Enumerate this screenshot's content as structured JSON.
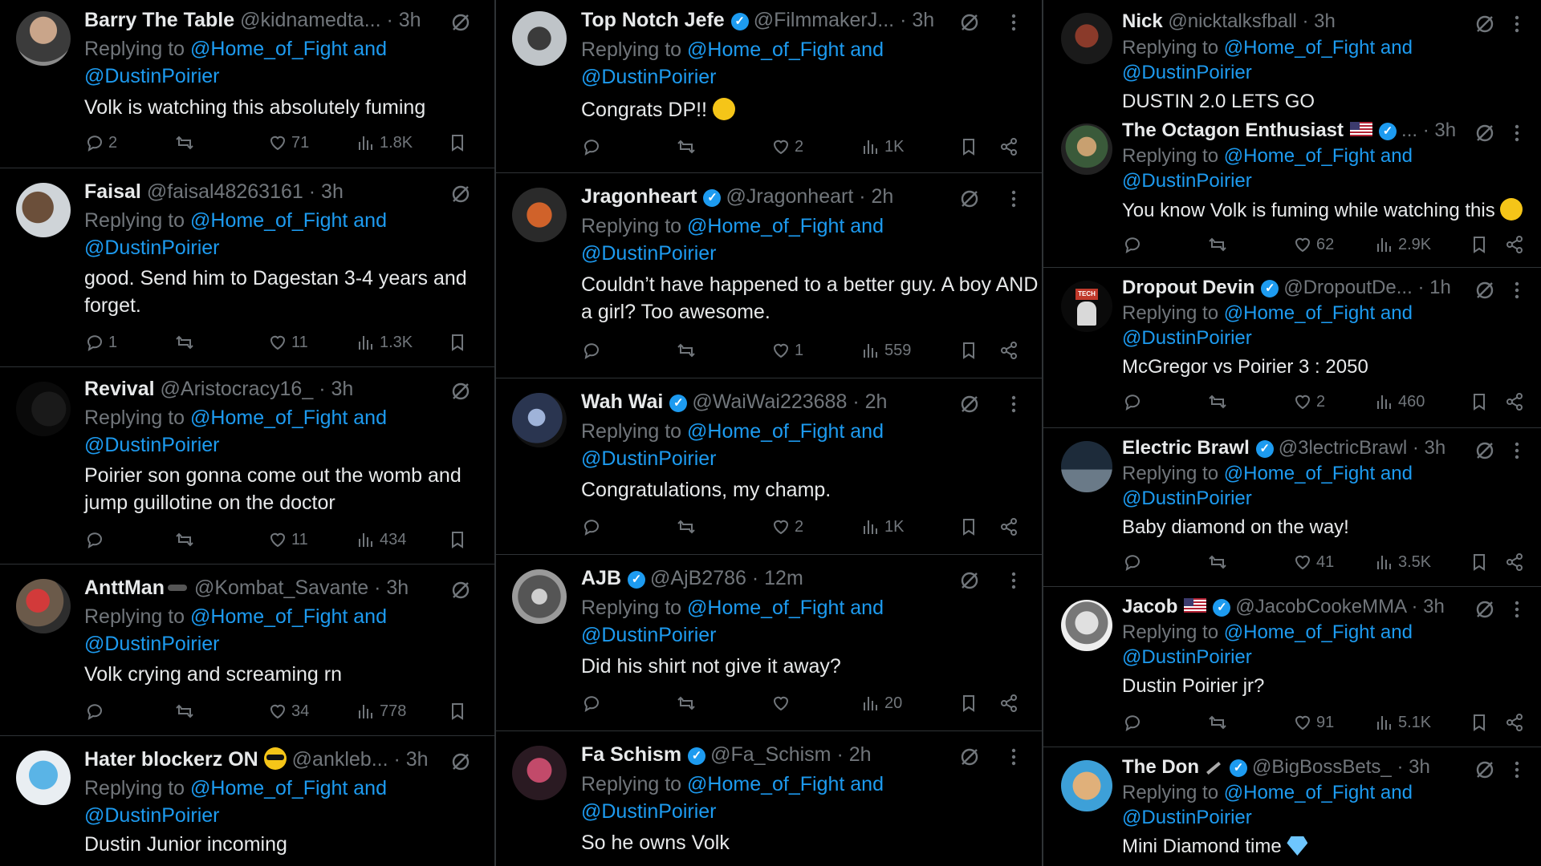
{
  "colors": {
    "background": "#000000",
    "text": "#e7e9ea",
    "muted": "#71767b",
    "link": "#1d9bf0",
    "divider": "#2f3336",
    "verified": "#1d9bf0"
  },
  "icons": {
    "reply": "reply-icon",
    "retweet": "retweet-icon",
    "like": "heart-icon",
    "views": "views-icon",
    "bookmark": "bookmark-icon",
    "share": "share-icon",
    "grok": "grok-icon",
    "more": "more-icon"
  },
  "columns": [
    {
      "tweets": [
        {
          "name": "Barry The Table",
          "handle": "@kidnamedta...",
          "time": "· 3h",
          "replying_prefix": "Replying to",
          "replying_link1": "@Home_of_Fight and",
          "replying_link2": "@DustinPoirier",
          "text": "Volk is watching this absolutely fuming",
          "replies": "2",
          "retweets": "",
          "likes": "71",
          "views": "1.8K"
        },
        {
          "name": "Faisal",
          "handle": "@faisal48263161",
          "time": "· 3h",
          "replying_prefix": "Replying to",
          "replying_link1": "@Home_of_Fight and",
          "replying_link2": "@DustinPoirier",
          "text": "good. Send him to Dagestan 3-4 years and forget.",
          "replies": "1",
          "retweets": "",
          "likes": "11",
          "views": "1.3K"
        },
        {
          "name": "Revival",
          "handle": "@Aristocracy16_",
          "time": "· 3h",
          "replying_prefix": "Replying to",
          "replying_link1": "@Home_of_Fight and",
          "replying_link2": "@DustinPoirier",
          "text": "Poirier son gonna come out the womb and jump guillotine on the doctor",
          "replies": "",
          "retweets": "",
          "likes": "11",
          "views": "434"
        },
        {
          "name": "AnttMan",
          "handle": "@Kombat_Savante",
          "time": "· 3h",
          "replying_prefix": "Replying to",
          "replying_link1": "@Home_of_Fight and",
          "replying_link2": "@DustinPoirier",
          "text": "Volk crying and screaming rn",
          "replies": "",
          "retweets": "",
          "likes": "34",
          "views": "778"
        },
        {
          "name": "Hater blockerz ON",
          "handle": "@ankleb...",
          "time": "· 3h",
          "replying_prefix": "Replying to",
          "replying_link1": "@Home_of_Fight and",
          "replying_link2": "@DustinPoirier",
          "text": "Dustin Junior incoming"
        }
      ]
    },
    {
      "tweets": [
        {
          "name": "Top Notch Jefe",
          "handle": "@FilmmakerJ...",
          "time": "· 3h",
          "replying_prefix": "Replying to",
          "replying_link1": "@Home_of_Fight and",
          "replying_link2": "@DustinPoirier",
          "text": "Congrats DP!!",
          "replies": "",
          "retweets": "",
          "likes": "2",
          "views": "1K"
        },
        {
          "name": "Jragonheart",
          "handle": "@Jragonheart",
          "time": "· 2h",
          "replying_prefix": "Replying to",
          "replying_link1": "@Home_of_Fight and",
          "replying_link2": "@DustinPoirier",
          "text": "Couldn’t have happened to a better guy. A boy AND a girl? Too awesome.",
          "replies": "",
          "retweets": "",
          "likes": "1",
          "views": "559"
        },
        {
          "name": "Wah Wai",
          "handle": "@WaiWai223688",
          "time": "· 2h",
          "replying_prefix": "Replying to",
          "replying_link1": "@Home_of_Fight and",
          "replying_link2": "@DustinPoirier",
          "text": "Congratulations, my champ.",
          "replies": "",
          "retweets": "",
          "likes": "2",
          "views": "1K"
        },
        {
          "name": "AJB",
          "handle": "@AjB2786",
          "time": "· 12m",
          "replying_prefix": "Replying to",
          "replying_link1": "@Home_of_Fight and",
          "replying_link2": "@DustinPoirier",
          "text": "Did his shirt not give it away?",
          "replies": "",
          "retweets": "",
          "likes": "",
          "views": "20"
        },
        {
          "name": "Fa Schism",
          "handle": "@Fa_Schism",
          "time": "· 2h",
          "replying_prefix": "Replying to",
          "replying_link1": "@Home_of_Fight and",
          "replying_link2": "@DustinPoirier",
          "text": "So he owns Volk"
        }
      ]
    },
    {
      "tweets": [
        {
          "name": "Nick",
          "handle": "@nicktalksfball",
          "time": "· 3h",
          "replying_prefix": "Replying to",
          "replying_link1": "@Home_of_Fight and",
          "replying_link2": "@DustinPoirier",
          "text": "DUSTIN 2.0 LETS GO"
        },
        {
          "name": "The Octagon Enthusiast",
          "handle": "...",
          "time": "· 3h",
          "replying_prefix": "Replying to",
          "replying_link1": "@Home_of_Fight and",
          "replying_link2": "@DustinPoirier",
          "text": "You know Volk is fuming while watching this",
          "replies": "",
          "retweets": "",
          "likes": "62",
          "views": "2.9K"
        },
        {
          "name": "Dropout Devin",
          "handle": "@DropoutDe...",
          "time": "· 1h",
          "replying_prefix": "Replying to",
          "replying_link1": "@Home_of_Fight and",
          "replying_link2": "@DustinPoirier",
          "text": "McGregor vs Poirier 3 : 2050",
          "replies": "",
          "retweets": "",
          "likes": "2",
          "views": "460",
          "avatar_text": "TECH"
        },
        {
          "name": "Electric Brawl",
          "handle": "@3lectricBrawl",
          "time": "· 3h",
          "replying_prefix": "Replying to",
          "replying_link1": "@Home_of_Fight and",
          "replying_link2": "@DustinPoirier",
          "text": "Baby diamond on the way!",
          "replies": "",
          "retweets": "",
          "likes": "41",
          "views": "3.5K"
        },
        {
          "name": "Jacob",
          "handle": "@JacobCookeMMA",
          "time": "· 3h",
          "replying_prefix": "Replying to",
          "replying_link1": "@Home_of_Fight and",
          "replying_link2": "@DustinPoirier",
          "text": "Dustin Poirier jr?",
          "replies": "",
          "retweets": "",
          "likes": "91",
          "views": "5.1K"
        },
        {
          "name": "The Don",
          "handle": "@BigBossBets_",
          "time": "· 3h",
          "replying_prefix": "Replying to",
          "replying_link1": "@Home_of_Fight and",
          "replying_link2": "@DustinPoirier",
          "text": "Mini Diamond time"
        }
      ]
    }
  ]
}
